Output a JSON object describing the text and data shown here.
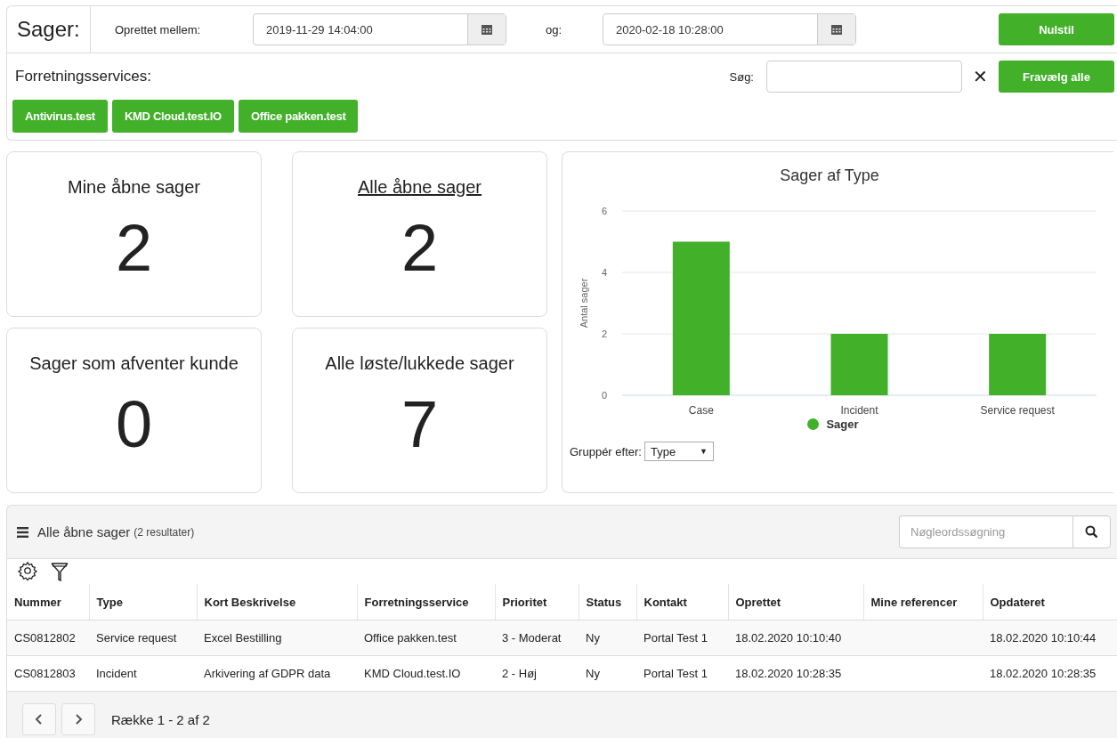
{
  "filter": {
    "title": "Sager:",
    "created_between_label": "Oprettet mellem:",
    "from_date": "2019-11-29 14:04:00",
    "and_label": "og:",
    "to_date": "2020-02-18 10:28:00",
    "reset_button": "Nulstil"
  },
  "services": {
    "label": "Forretningsservices:",
    "search_label": "Søg:",
    "clear_icon": "✕",
    "deselect_button": "Fravælg alle",
    "tags": [
      "Antivirus.test",
      "KMD Cloud.test.IO",
      "Office pakken.test"
    ]
  },
  "stats": [
    {
      "label": "Mine åbne sager",
      "value": "2",
      "link": false
    },
    {
      "label": "Alle åbne sager",
      "value": "2",
      "link": true
    },
    {
      "label": "Sager som afventer kunde",
      "value": "0",
      "link": false
    },
    {
      "label": "Alle løste/lukkede sager",
      "value": "7",
      "link": false
    }
  ],
  "chart": {
    "group_label": "Gruppér efter:",
    "group_value": "Type",
    "group_caret": "▼",
    "chart_data": {
      "type": "bar",
      "title": "Sager af Type",
      "ylabel": "Antal sager",
      "categories": [
        "Case",
        "Incident",
        "Service request"
      ],
      "series": [
        {
          "name": "Sager",
          "color": "#43b02a",
          "values": [
            5,
            2,
            2
          ]
        }
      ],
      "ylim": [
        0,
        6
      ],
      "yticks": [
        0,
        2,
        4,
        6
      ]
    }
  },
  "list": {
    "title": "Alle åbne sager",
    "count": "(2 resultater)",
    "search_placeholder": "Nøgleordssøgning",
    "columns": [
      "Nummer",
      "Type",
      "Kort Beskrivelse",
      "Forretningsservice",
      "Prioritet",
      "Status",
      "Kontakt",
      "Oprettet",
      "Mine referencer",
      "Opdateret"
    ],
    "rows": [
      [
        "CS0812802",
        "Service request",
        "Excel Bestilling",
        "Office pakken.test",
        "3 - Moderat",
        "Ny",
        "Portal Test 1",
        "18.02.2020 10:10:40",
        "",
        "18.02.2020 10:10:44"
      ],
      [
        "CS0812803",
        "Incident",
        "Arkivering af GDPR data",
        "KMD Cloud.test.IO",
        "2 - Høj",
        "Ny",
        "Portal Test 1",
        "18.02.2020 10:28:35",
        "",
        "18.02.2020 10:28:35"
      ]
    ],
    "pagination": "Række 1 - 2 af 2"
  }
}
